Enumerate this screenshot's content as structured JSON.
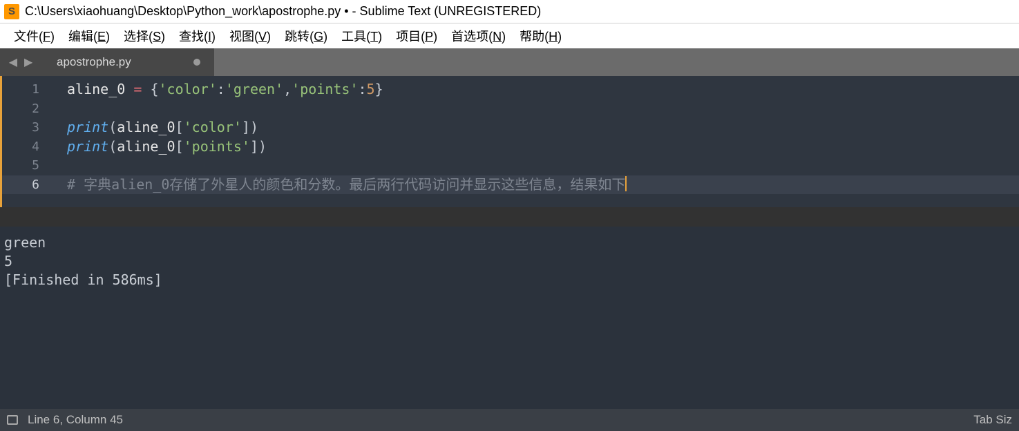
{
  "window": {
    "title": "C:\\Users\\xiaohuang\\Desktop\\Python_work\\apostrophe.py • - Sublime Text (UNREGISTERED)",
    "app_glyph": "S"
  },
  "menu": {
    "file": {
      "label": "文件",
      "accel": "F"
    },
    "edit": {
      "label": "编辑",
      "accel": "E"
    },
    "select": {
      "label": "选择",
      "accel": "S"
    },
    "find": {
      "label": "查找",
      "accel": "I"
    },
    "view": {
      "label": "视图",
      "accel": "V"
    },
    "goto": {
      "label": "跳转",
      "accel": "G"
    },
    "tools": {
      "label": "工具",
      "accel": "T"
    },
    "project": {
      "label": "项目",
      "accel": "P"
    },
    "prefs": {
      "label": "首选项",
      "accel": "N"
    },
    "help": {
      "label": "帮助",
      "accel": "H"
    }
  },
  "nav": {
    "back": "◀",
    "fwd": "▶"
  },
  "tab": {
    "label": "apostrophe.py"
  },
  "code": {
    "l1": {
      "var": "aline_0",
      "op": "=",
      "b1": "{",
      "s1": "'color'",
      "c1": ":",
      "s2": "'green'",
      "cm": ",",
      "s3": "'points'",
      "c2": ":",
      "n": "5",
      "b2": "}"
    },
    "l3": {
      "fn": "print",
      "p1": "(",
      "var": "aline_0",
      "b1": "[",
      "s": "'color'",
      "b2": "]",
      "p2": ")"
    },
    "l4": {
      "fn": "print",
      "p1": "(",
      "var": "aline_0",
      "b1": "[",
      "s": "'points'",
      "b2": "]",
      "p2": ")"
    },
    "l6": {
      "comment": "# 字典alien_0存储了外星人的颜色和分数。最后两行代码访问并显示这些信息，结果如下"
    }
  },
  "lines": {
    "n1": "1",
    "n2": "2",
    "n3": "3",
    "n4": "4",
    "n5": "5",
    "n6": "6"
  },
  "output": {
    "l1": "green",
    "l2": "5",
    "l3": "[Finished in 586ms]"
  },
  "status": {
    "cursor": "Line 6, Column 45",
    "tabsize": "Tab Siz"
  }
}
